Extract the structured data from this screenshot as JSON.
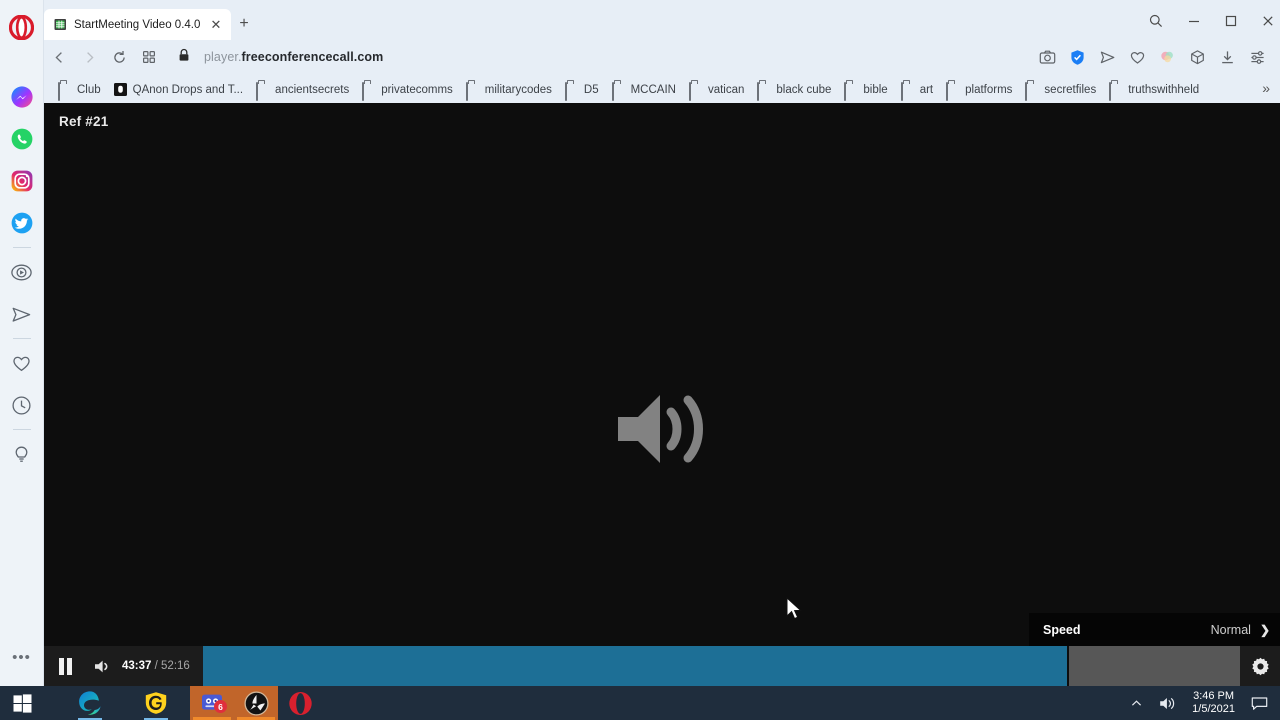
{
  "window": {
    "controls": [
      {
        "name": "search-icon",
        "glyph": "search"
      },
      {
        "name": "minimize-button",
        "glyph": "minimize"
      },
      {
        "name": "maximize-button",
        "glyph": "maximize"
      },
      {
        "name": "close-button",
        "glyph": "close"
      }
    ]
  },
  "tab": {
    "title": "StartMeeting Video 0.4.0",
    "close_label": "✕",
    "new_tab_label": "+"
  },
  "navigation": {
    "back_label": "back-arrow",
    "forward_label": "forward-arrow",
    "reload_label": "reload",
    "tiles_label": "page-tiles",
    "lock_label": "lock",
    "url_prefix": "player.",
    "url_domain": "freeconferencecall.com"
  },
  "toolbar_icons": [
    {
      "name": "snapshot-icon",
      "title": "Snapshot"
    },
    {
      "name": "vpn-shield-icon",
      "title": "VPN"
    },
    {
      "name": "send-to-device-icon",
      "title": "Send to device"
    },
    {
      "name": "heart-icon",
      "title": "Favorites"
    },
    {
      "name": "pinboard-icon",
      "title": "Pinboards"
    },
    {
      "name": "workspace-cube-icon",
      "title": "Workspaces"
    },
    {
      "name": "downloads-icon",
      "title": "Downloads"
    },
    {
      "name": "easy-setup-icon",
      "title": "Easy setup"
    }
  ],
  "bookmarks": {
    "items": [
      {
        "label": "Club",
        "icon": "folder"
      },
      {
        "label": "QAnon Drops and T...",
        "icon": "site"
      },
      {
        "label": "ancientsecrets",
        "icon": "folder"
      },
      {
        "label": "privatecomms",
        "icon": "folder"
      },
      {
        "label": "militarycodes",
        "icon": "folder"
      },
      {
        "label": "D5",
        "icon": "folder"
      },
      {
        "label": "MCCAIN",
        "icon": "folder"
      },
      {
        "label": "vatican",
        "icon": "folder"
      },
      {
        "label": "black cube",
        "icon": "folder"
      },
      {
        "label": "bible",
        "icon": "folder"
      },
      {
        "label": "art",
        "icon": "folder"
      },
      {
        "label": "platforms",
        "icon": "folder"
      },
      {
        "label": "secretfiles",
        "icon": "folder"
      },
      {
        "label": "truthswithheld",
        "icon": "folder"
      }
    ],
    "overflow_label": "»"
  },
  "sidebar": {
    "items": [
      {
        "name": "opera-logo",
        "label": "Opera"
      },
      {
        "name": "messenger-icon",
        "label": "Messenger"
      },
      {
        "name": "whatsapp-icon",
        "label": "WhatsApp"
      },
      {
        "name": "instagram-icon",
        "label": "Instagram"
      },
      {
        "name": "twitter-icon",
        "label": "Twitter"
      },
      {
        "name": "player-icon",
        "label": "Player"
      },
      {
        "name": "telegram-icon",
        "label": "Telegram"
      },
      {
        "name": "favorites-heart-icon",
        "label": "Favorites"
      },
      {
        "name": "history-clock-icon",
        "label": "History"
      },
      {
        "name": "tips-bulb-icon",
        "label": "Tips"
      }
    ],
    "more_label": "•••"
  },
  "player": {
    "ref_title": "Ref #21",
    "audio_only_icon": "speaker-waves-icon",
    "progress_percent": 83.5,
    "buffered_percent": 100,
    "time_current": "43:37",
    "time_separator": "/",
    "time_duration": "52:16",
    "pause_label": "Pause",
    "volume_label": "Mute",
    "settings_label": "Settings"
  },
  "speed_menu": {
    "label": "Speed",
    "value": "Normal",
    "arrow": "❯"
  },
  "taskbar": {
    "items": [
      {
        "name": "start-button",
        "label": "Start"
      },
      {
        "name": "edge-icon",
        "label": "Microsoft Edge"
      },
      {
        "name": "glary-icon",
        "label": "G"
      },
      {
        "name": "messaging-icon",
        "label": "Messaging",
        "badge": "6"
      },
      {
        "name": "media-icon",
        "label": "Media Player"
      },
      {
        "name": "opera-taskbar-icon",
        "label": "Opera"
      }
    ],
    "tray": {
      "chevron_label": "⌃",
      "volume_label": "Volume",
      "time": "3:46 PM",
      "date": "1/5/2021",
      "notifications_label": "Notifications"
    }
  },
  "colors": {
    "chrome_bg": "#e7eef6",
    "player_bg": "#0d0d0d",
    "progress_fill": "#1d6f96",
    "taskbar_bg": "#1f2d3d",
    "taskbar_active": "#c1652a"
  }
}
